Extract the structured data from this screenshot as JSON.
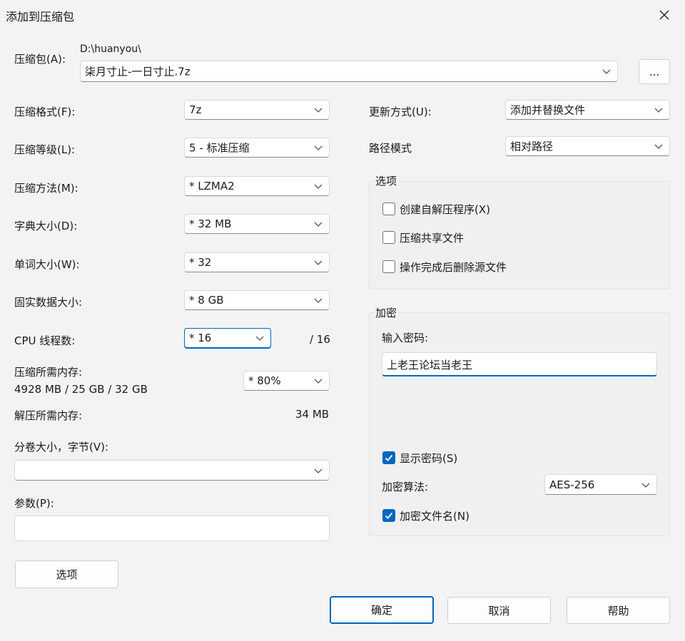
{
  "window": {
    "title": "添加到压缩包"
  },
  "archive": {
    "label": "压缩包(A):",
    "path": "D:\\huanyou\\",
    "filename": "柒月寸止-一日寸止.7z",
    "browse_label": "..."
  },
  "left": {
    "format": {
      "label": "压缩格式(F):",
      "value": "7z"
    },
    "level": {
      "label": "压缩等级(L):",
      "value": "5 - 标准压缩"
    },
    "method": {
      "label": "压缩方法(M):",
      "value": "* LZMA2"
    },
    "dict": {
      "label": "字典大小(D):",
      "value": "* 32 MB"
    },
    "word": {
      "label": "单词大小(W):",
      "value": "* 32"
    },
    "solid": {
      "label": "固实数据大小:",
      "value": "* 8 GB"
    },
    "threads": {
      "label": "CPU 线程数:",
      "value": "* 16",
      "max": "/ 16"
    },
    "mem_compress": {
      "label": "压缩所需内存:",
      "detail": "4928 MB / 25 GB / 32 GB",
      "value": "* 80%"
    },
    "mem_decompress": {
      "label": "解压所需内存:",
      "value": "34 MB"
    },
    "volume": {
      "label": "分卷大小，字节(V):",
      "value": ""
    },
    "params": {
      "label": "参数(P):",
      "value": ""
    },
    "options_button": "选项"
  },
  "right": {
    "update": {
      "label": "更新方式(U):",
      "value": "添加并替换文件"
    },
    "path_mode": {
      "label": "路径模式",
      "value": "相对路径"
    },
    "options_group": {
      "title": "选项",
      "items": [
        {
          "label": "创建自解压程序(X)",
          "checked": false
        },
        {
          "label": "压缩共享文件",
          "checked": false
        },
        {
          "label": "操作完成后删除源文件",
          "checked": false
        }
      ]
    },
    "encrypt_group": {
      "title": "加密",
      "password_label": "输入密码:",
      "password_value": "上老王论坛当老王",
      "show_password": {
        "label": "显示密码(S)",
        "checked": true
      },
      "algo_label": "加密算法:",
      "algo_value": "AES-256",
      "encrypt_names": {
        "label": "加密文件名(N)",
        "checked": true
      }
    }
  },
  "footer": {
    "ok": "确定",
    "cancel": "取消",
    "help": "帮助"
  },
  "colors": {
    "accent": "#0067c0",
    "background": "#f3f3f3"
  },
  "icons": [
    "close-icon",
    "chevron-down-icon",
    "checkmark-icon"
  ]
}
